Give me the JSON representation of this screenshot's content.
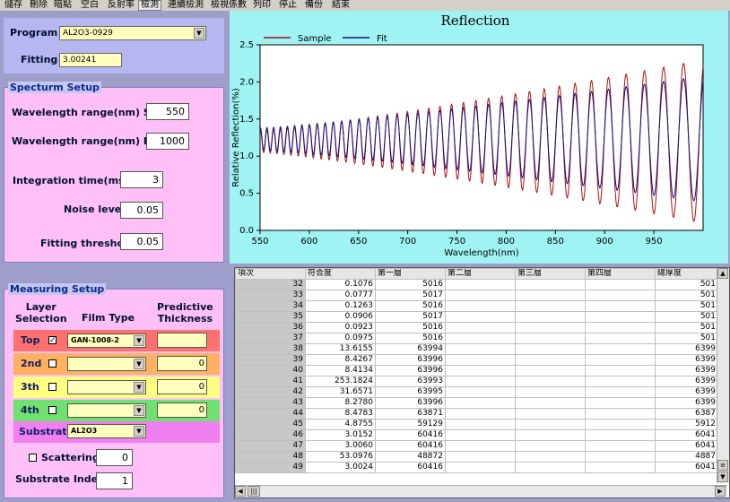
{
  "menu": [
    "儲存",
    "刪除",
    "暗點",
    "空白",
    "反射率",
    "檢測",
    "連續檢測",
    "檢視係數",
    "列印",
    "停止",
    "備份",
    "結束"
  ],
  "program": {
    "label": "Program",
    "value": "AL2O3-0929"
  },
  "fitting": {
    "label": "Fitting",
    "value": "3.00241"
  },
  "spectrum": {
    "title": "Specturm Setup",
    "start_label": "Wavelength range(nm) Start",
    "start_value": "550",
    "end_label": "Wavelength range(nm)  End",
    "end_value": "1000",
    "integration_label": "Integration time(msec)",
    "integration_value": "3",
    "noise_label": "Noise level",
    "noise_value": "0.05",
    "threshold_label": "Fitting threshold",
    "threshold_value": "0.05"
  },
  "measuring": {
    "title": "Measuring Setup",
    "col_layer": "Layer\nSelection",
    "col_film": "Film Type",
    "col_thickness": "Predictive\nThickness",
    "layers": [
      {
        "name": "Top",
        "checked": true,
        "film": "GAN-1008-2",
        "thickness": "",
        "color": "#ff7070"
      },
      {
        "name": "2nd",
        "checked": false,
        "film": "",
        "thickness": "0",
        "color": "#ffb060"
      },
      {
        "name": "3th",
        "checked": false,
        "film": "",
        "thickness": "0",
        "color": "#ffff80"
      },
      {
        "name": "4th",
        "checked": false,
        "film": "",
        "thickness": "0",
        "color": "#70e070"
      }
    ],
    "substrate_label": "Substrate",
    "substrate_value": "AL2O3",
    "substrate_color": "#f080f0",
    "scattering_label": "Scattering",
    "scattering_value": "0",
    "index_label": "Substrate Index",
    "index_value": "1"
  },
  "chart_data": {
    "type": "line",
    "title": "Reflection",
    "xlabel": "Wavelength(nm)",
    "ylabel": "Relative Reflection(%)",
    "xlim": [
      550,
      1000
    ],
    "ylim": [
      0,
      2.5
    ],
    "xticks": [
      550,
      600,
      650,
      700,
      750,
      800,
      850,
      900,
      950
    ],
    "yticks": [
      0.0,
      0.5,
      1.0,
      1.5,
      2.0,
      2.5
    ],
    "series": [
      {
        "name": "Sample",
        "color": "#b01010",
        "center": 1.2,
        "amp_start": 0.15,
        "amp_end": 1.1,
        "fringes": 38
      },
      {
        "name": "Fit",
        "color": "#101080",
        "center": 1.2,
        "amp_start": 0.15,
        "amp_end": 0.85,
        "fringes": 38
      }
    ]
  },
  "table": {
    "headers": [
      "項次",
      "符合度",
      "第一層",
      "第二層",
      "第三層",
      "第四層",
      "總厚度"
    ],
    "rows": [
      [
        "32",
        "0.1076",
        "5016",
        "",
        "",
        "",
        "501"
      ],
      [
        "33",
        "0.0777",
        "5017",
        "",
        "",
        "",
        "501"
      ],
      [
        "34",
        "0.1263",
        "5016",
        "",
        "",
        "",
        "501"
      ],
      [
        "35",
        "0.0906",
        "5017",
        "",
        "",
        "",
        "501"
      ],
      [
        "36",
        "0.0923",
        "5016",
        "",
        "",
        "",
        "501"
      ],
      [
        "37",
        "0.0975",
        "5016",
        "",
        "",
        "",
        "501"
      ],
      [
        "38",
        "13.6155",
        "63994",
        "",
        "",
        "",
        "6399"
      ],
      [
        "39",
        "8.4267",
        "63996",
        "",
        "",
        "",
        "6399"
      ],
      [
        "40",
        "8.4134",
        "63996",
        "",
        "",
        "",
        "6399"
      ],
      [
        "41",
        "253.1824",
        "63993",
        "",
        "",
        "",
        "6399"
      ],
      [
        "42",
        "31.6571",
        "63995",
        "",
        "",
        "",
        "6399"
      ],
      [
        "43",
        "8.2780",
        "63996",
        "",
        "",
        "",
        "6399"
      ],
      [
        "44",
        "8.4783",
        "63871",
        "",
        "",
        "",
        "6387"
      ],
      [
        "45",
        "4.8755",
        "59129",
        "",
        "",
        "",
        "5912"
      ],
      [
        "46",
        "3.0152",
        "60416",
        "",
        "",
        "",
        "6041"
      ],
      [
        "47",
        "3.0060",
        "60416",
        "",
        "",
        "",
        "6041"
      ],
      [
        "48",
        "53.0976",
        "48872",
        "",
        "",
        "",
        "4887"
      ],
      [
        "49",
        "3.0024",
        "60416",
        "",
        "",
        "",
        "6041"
      ]
    ]
  }
}
